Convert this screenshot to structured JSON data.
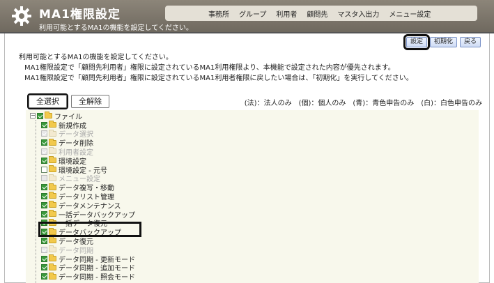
{
  "header": {
    "title": "MA1権限設定",
    "subtitle": "利用可能とするMA1の機能を設定してください。",
    "nav": [
      "事務所",
      "グループ",
      "利用者",
      "顧問先",
      "マスタ入出力",
      "メニュー設定"
    ]
  },
  "toolbar": {
    "settings": "設定",
    "reset": "初期化",
    "back": "戻る"
  },
  "description": [
    "利用可能とするMA1の機能を設定してください。",
    "MA1権限設定で「顧問先利用者」権限に設定されているMA1利用権限より、本機能で設定された内容が優先されます。",
    "MA1権限設定で「顧問先利用者」権限に設定されているMA1利用者権限に戻したい場合は、「初期化」を実行してください。"
  ],
  "select_all": "全選択",
  "deselect_all": "全解除",
  "legend": "(法)：法人のみ　(個)：個人のみ　(青)：青色申告のみ　(白)：白色申告のみ",
  "tree": {
    "root": "ファイル",
    "items": [
      {
        "label": "新規作成",
        "checked": true,
        "enabled": true
      },
      {
        "label": "データ選択",
        "checked": true,
        "enabled": false
      },
      {
        "label": "データ削除",
        "checked": true,
        "enabled": true
      },
      {
        "label": "利用者設定",
        "checked": true,
        "enabled": false
      },
      {
        "label": "環境設定",
        "checked": true,
        "enabled": true
      },
      {
        "label": "環境設定 - 元号",
        "checked": false,
        "enabled": true
      },
      {
        "label": "メニュー設定",
        "checked": false,
        "enabled": false
      },
      {
        "label": "データ複写・移動",
        "checked": true,
        "enabled": true
      },
      {
        "label": "データリスト管理",
        "checked": true,
        "enabled": true
      },
      {
        "label": "データメンテナンス",
        "checked": true,
        "enabled": true
      },
      {
        "label": "一括データバックアップ",
        "checked": true,
        "enabled": true
      },
      {
        "label": "一括データ復元",
        "checked": true,
        "enabled": true
      },
      {
        "label": "データバックアップ",
        "checked": true,
        "enabled": true
      },
      {
        "label": "データ復元",
        "checked": true,
        "enabled": true
      },
      {
        "label": "データ同期",
        "checked": true,
        "enabled": false
      },
      {
        "label": "データ同期 - 更新モード",
        "checked": true,
        "enabled": true
      },
      {
        "label": "データ同期 - 追加モード",
        "checked": true,
        "enabled": true
      },
      {
        "label": "データ同期 - 照会モード",
        "checked": true,
        "enabled": true
      }
    ]
  }
}
